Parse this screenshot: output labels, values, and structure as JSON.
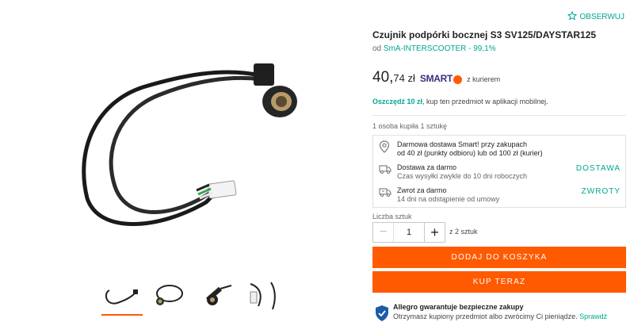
{
  "product": {
    "title": "Czujnik podpórki bocznej S3 SV125/DAYSTAR125",
    "seller_prefix": "od",
    "seller_name": "SmA-INTERSCOOTER - 99,1%",
    "price_int": "40,",
    "price_dec": "74 zł",
    "smart_label": "SMART",
    "courier_label": "z kurierem",
    "save_bold": "Oszczędź 10 zł",
    "save_text": ", kup ten przedmiot w aplikacji mobilnej.",
    "bought": "1 osoba kupiła 1 sztukę"
  },
  "actions": {
    "follow_label": "OBSERWUJ",
    "add_to_cart": "DODAJ DO KOSZYKA",
    "buy_now": "KUP TERAZ"
  },
  "delivery": {
    "smart_line1": "Darmowa dostawa Smart! przy zakupach",
    "smart_line2": "od 40 zł (punkty odbioru) lub od 100 zł (kurier)",
    "free_title": "Dostawa za darmo",
    "free_sub": "Czas wysyłki zwykle do 10 dni roboczych",
    "free_link": "DOSTAWA",
    "return_title": "Zwrot za darmo",
    "return_sub": "14 dni na odstąpienie od umowy",
    "return_link": "ZWROTY"
  },
  "quantity": {
    "label": "Liczba sztuk",
    "value": "1",
    "minus": "−",
    "plus": "+",
    "of_total": "z 2 sztuk"
  },
  "guarantee": {
    "title": "Allegro gwarantuje bezpieczne zakupy",
    "text": "Otrzymasz kupiony przedmiot albo zwrócimy Ci pieniądze.",
    "link": "Sprawdź"
  },
  "gallery": {
    "thumbnail_count": 4,
    "active_index": 0
  },
  "colors": {
    "accent": "#ff5a00",
    "link": "#00a790",
    "smart": "#3a2f7a"
  }
}
